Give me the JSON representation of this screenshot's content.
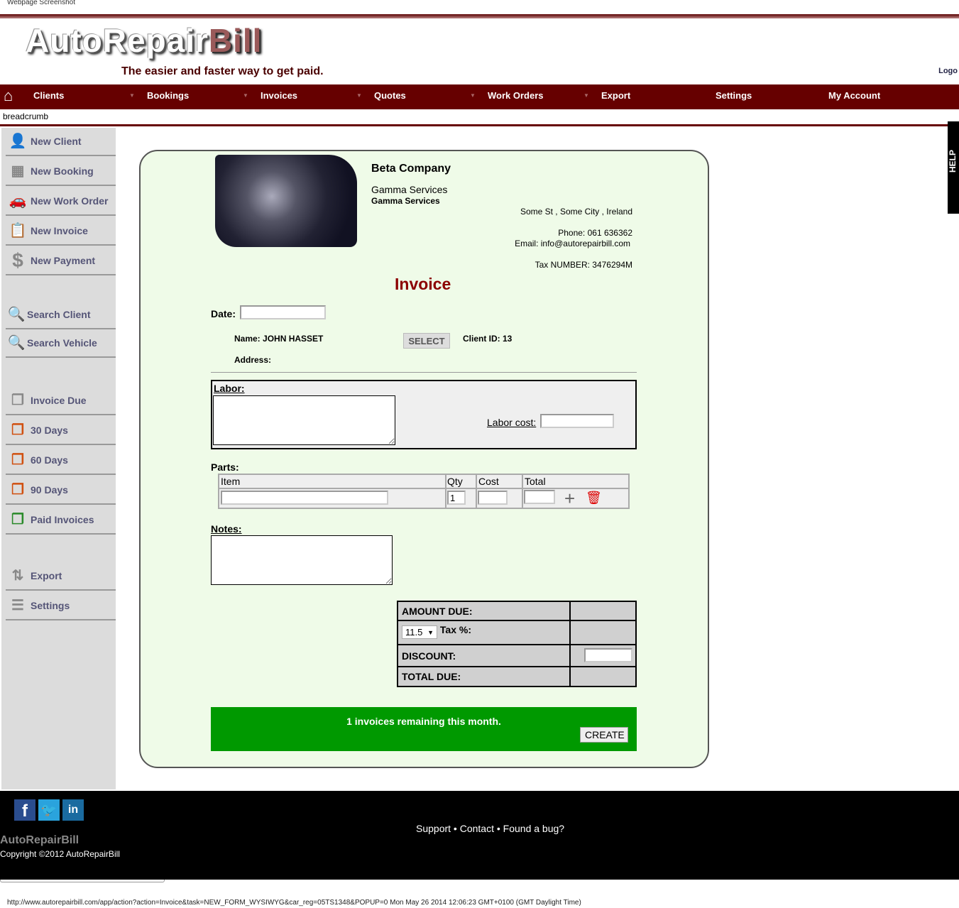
{
  "capture_label": "Webpage Screenshot",
  "brand": {
    "logo_part1": "AutoRepair",
    "logo_part2": "Bill",
    "tagline": "The easier and faster way to get paid.",
    "logo_link": "Logo"
  },
  "nav": {
    "home_icon": "home-icon",
    "items": [
      {
        "label": "Clients"
      },
      {
        "label": "Bookings"
      },
      {
        "label": "Invoices"
      },
      {
        "label": "Quotes"
      },
      {
        "label": "Work Orders"
      },
      {
        "label": "Export"
      },
      {
        "label": "Settings"
      },
      {
        "label": "My Account"
      }
    ]
  },
  "breadcrumb": "breadcrumb",
  "help_tab": "HELP",
  "sidebar": {
    "items": [
      {
        "label": "New Client",
        "icon": "user-add-icon"
      },
      {
        "label": "New Booking",
        "icon": "calendar-icon"
      },
      {
        "label": "New Work Order",
        "icon": "car-icon"
      },
      {
        "label": "New Invoice",
        "icon": "clipboard-icon"
      },
      {
        "label": "New Payment",
        "icon": "dollar-icon"
      },
      {
        "label": "Search Client",
        "icon": "search-icon"
      },
      {
        "label": "Search Vehicle",
        "icon": "search-icon"
      },
      {
        "label": "Invoice Due",
        "icon": "document-gray-icon"
      },
      {
        "label": "30 Days",
        "icon": "document-orange-icon"
      },
      {
        "label": "60 Days",
        "icon": "document-orange-icon"
      },
      {
        "label": "90 Days",
        "icon": "document-orange-icon"
      },
      {
        "label": "Paid Invoices",
        "icon": "document-green-icon"
      },
      {
        "label": "Export",
        "icon": "export-arrows-icon"
      },
      {
        "label": "Settings",
        "icon": "sliders-icon"
      }
    ]
  },
  "company": {
    "name": "Beta Company",
    "line1": "Gamma Services",
    "line2": "Gamma Services",
    "address": "Some St , Some City , Ireland",
    "phone": "Phone: 061 636362",
    "email": "Email: info@autorepairbill.com",
    "tax": "Tax NUMBER: 3476294M"
  },
  "invoice": {
    "title": "Invoice",
    "date_label": "Date:",
    "date_value": "",
    "name": "Name: JOHN HASSET",
    "select_button": "SELECT",
    "client_id": "Client ID: 13",
    "address": "Address:",
    "labor_label": "Labor:",
    "labor_cost_label": "Labor cost:",
    "labor_value": "",
    "labor_cost_value": "",
    "parts_label": "Parts:",
    "parts_headers": [
      "Item",
      "Qty",
      "Cost",
      "Total"
    ],
    "parts_row": {
      "item": "",
      "qty": "1",
      "cost": "",
      "total": ""
    },
    "notes_label": "Notes:",
    "notes_value": "",
    "amount_due": "AMOUNT DUE:",
    "tax_select": "11.5",
    "tax_label": "Tax %:",
    "discount": "DISCOUNT:",
    "discount_value": "",
    "total_due": "TOTAL DUE:",
    "remaining": "1 invoices remaining this month.",
    "create_button": "CREATE"
  },
  "colors": {
    "nav": "#660000",
    "panel": "#effbe8",
    "banner": "#009900",
    "sidebar": "#dcdcdc"
  },
  "footer": {
    "social": [
      "facebook-icon",
      "twitter-icon",
      "linkedin-icon"
    ],
    "links": [
      "Support",
      "Contact",
      "Found a bug?"
    ],
    "brand": "AutoRepairBill",
    "copyright": "Copyright ©2012 AutoRepairBill"
  },
  "status_url": "http://www.autorepairbill.com/app/action?action=Invoice&task=NEW_FORM_WYSIWYG&car_reg=05TS1348&POPUP=0 Mon May 26 2014 12:06:23 GMT+0100 (GMT Daylight Time)"
}
